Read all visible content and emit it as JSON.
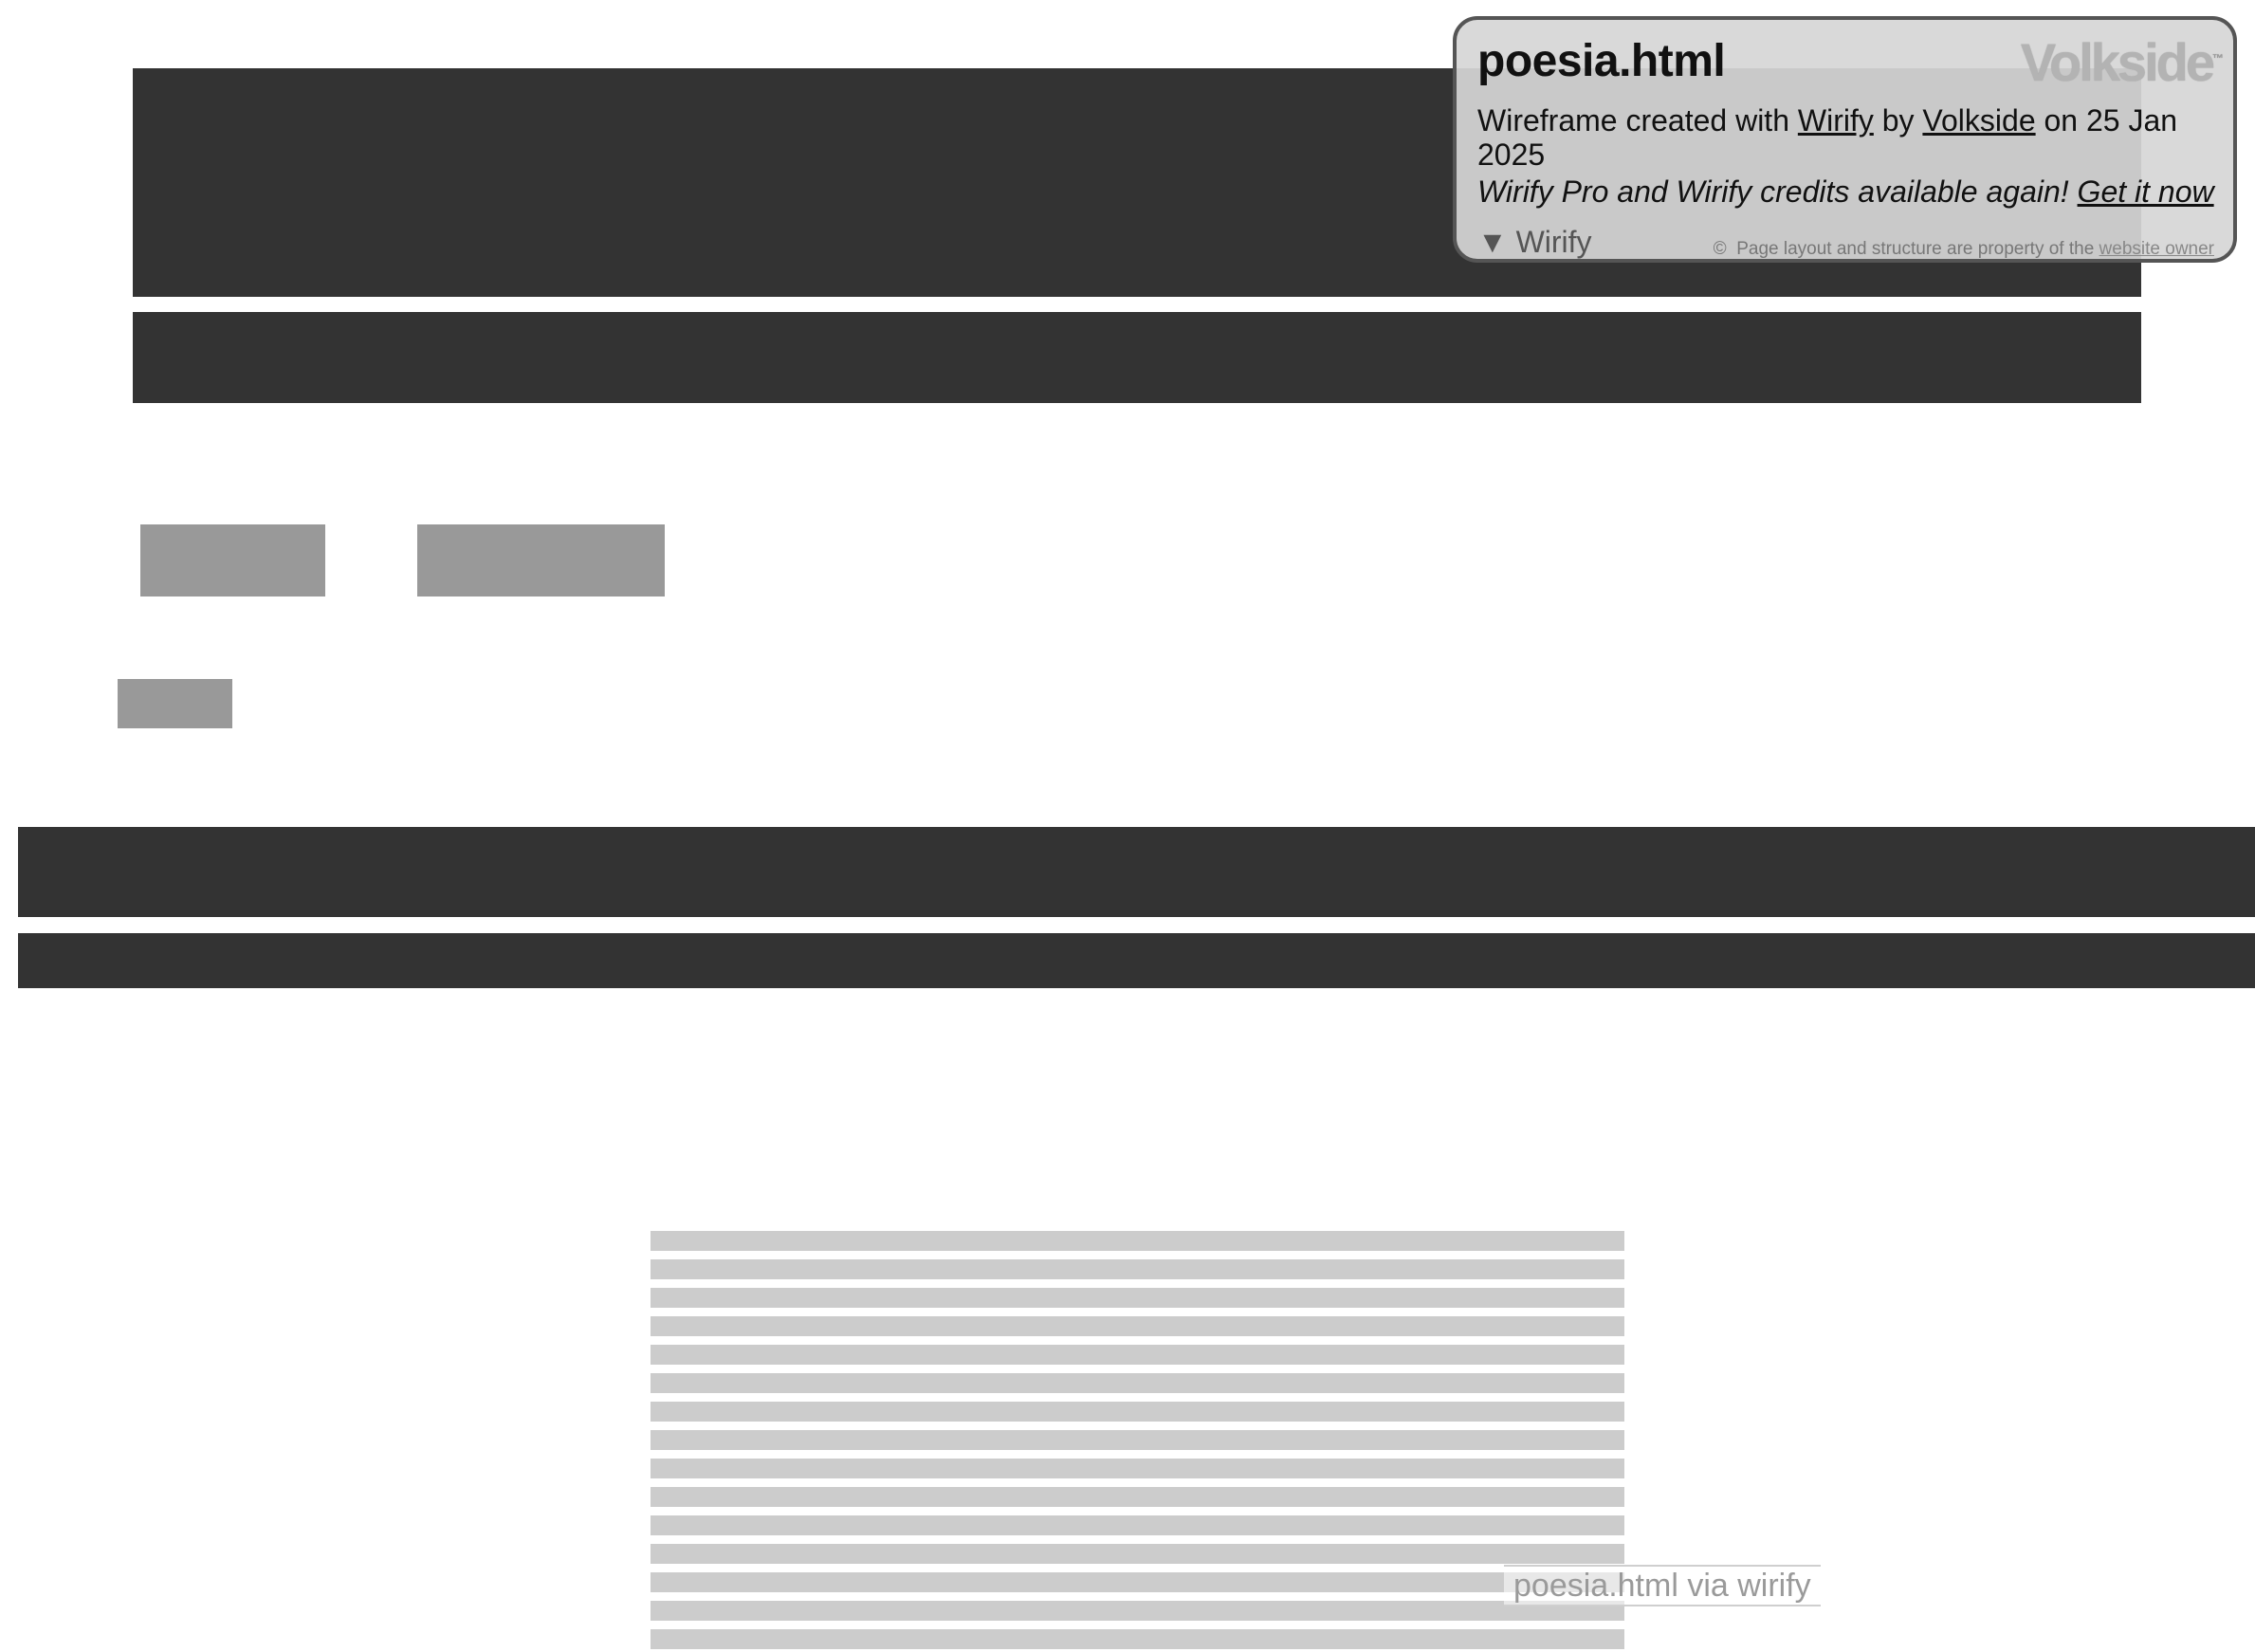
{
  "card": {
    "title": "poesia.html",
    "brand": "Volkside",
    "brand_mark": "™",
    "line1_prefix": "Wireframe created with ",
    "line1_link1": "Wirify",
    "line1_mid": " by ",
    "line1_link2": "Volkside",
    "line1_suffix": " on 25 Jan 2025",
    "line2_text": "Wirify Pro and Wirify credits available again! ",
    "line2_link": "Get it now",
    "toggle_icon": "▼",
    "toggle_label": "Wirify",
    "copyright_symbol": "©",
    "copyright_text": "Page layout and structure are property of the ",
    "copyright_link": "website owner"
  },
  "badge": {
    "text": "poesia.html via wirify"
  },
  "colors": {
    "dark_block": "#333333",
    "mid_block": "#999999",
    "light_block": "#cccccc",
    "card_bg": "#d6d6d6",
    "card_border": "#555555"
  }
}
